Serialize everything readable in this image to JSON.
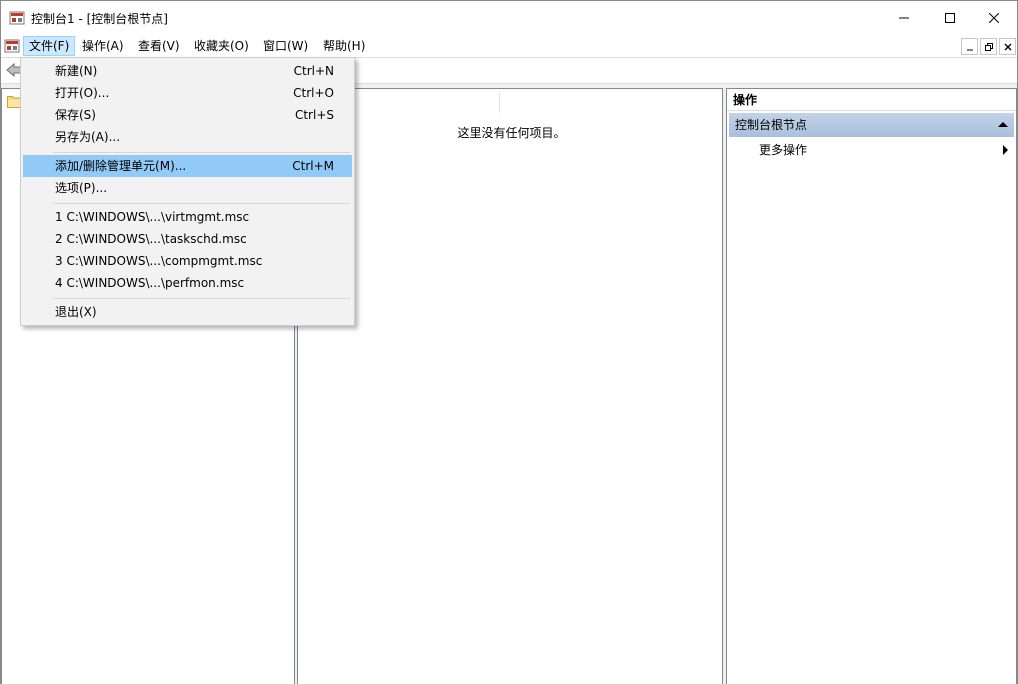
{
  "window": {
    "title": "控制台1 - [控制台根节点]"
  },
  "caption_buttons": [
    "minimize-icon",
    "maximize-icon",
    "close-icon"
  ],
  "menubar": {
    "items": [
      {
        "label": "文件(F)"
      },
      {
        "label": "操作(A)"
      },
      {
        "label": "查看(V)"
      },
      {
        "label": "收藏夹(O)"
      },
      {
        "label": "窗口(W)"
      },
      {
        "label": "帮助(H)"
      }
    ],
    "open_index": 0
  },
  "file_menu": {
    "items": [
      {
        "label": "新建(N)",
        "shortcut": "Ctrl+N"
      },
      {
        "label": "打开(O)...",
        "shortcut": "Ctrl+O"
      },
      {
        "label": "保存(S)",
        "shortcut": "Ctrl+S"
      },
      {
        "label": "另存为(A)...",
        "shortcut": ""
      },
      {
        "label": "添加/删除管理单元(M)...",
        "shortcut": "Ctrl+M",
        "highlighted": true
      },
      {
        "label": "选项(P)...",
        "shortcut": ""
      },
      {
        "label": "1 C:\\WINDOWS\\...\\virtmgmt.msc",
        "shortcut": ""
      },
      {
        "label": "2 C:\\WINDOWS\\...\\taskschd.msc",
        "shortcut": ""
      },
      {
        "label": "3 C:\\WINDOWS\\...\\compmgmt.msc",
        "shortcut": ""
      },
      {
        "label": "4 C:\\WINDOWS\\...\\perfmon.msc",
        "shortcut": ""
      },
      {
        "label": "退出(X)",
        "shortcut": ""
      }
    ]
  },
  "result_pane": {
    "empty_text": "这里没有任何项目。"
  },
  "actions_pane": {
    "header": "操作",
    "section_title": "控制台根节点",
    "items": [
      {
        "label": "更多操作"
      }
    ]
  },
  "colors": {
    "menu_highlight": "#91c9f7",
    "menubar_open": "#cce8ff",
    "section_gradient_top": "#c3d3e7",
    "section_gradient_bottom": "#a9bfdc"
  }
}
